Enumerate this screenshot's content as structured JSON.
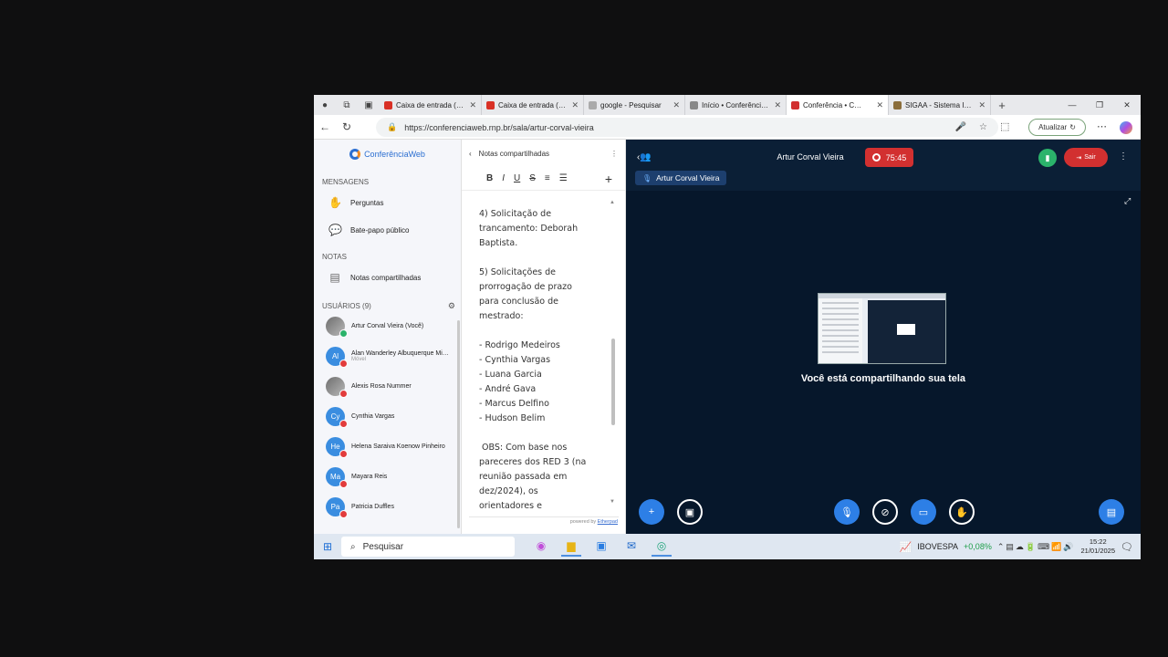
{
  "browser": {
    "tabs": [
      {
        "title": "Caixa de entrada (2…",
        "color": "#d93025",
        "active": false
      },
      {
        "title": "Caixa de entrada (1…",
        "color": "#d93025",
        "active": false
      },
      {
        "title": "google - Pesquisar",
        "color": "#aaaaaa",
        "active": false
      },
      {
        "title": "Início • Conferênci…",
        "color": "#888888",
        "active": false
      },
      {
        "title": "Conferência • C…",
        "color": "#d23030",
        "active": true
      },
      {
        "title": "SIGAA - Sistema Int…",
        "color": "#8a6d3b",
        "active": false
      }
    ],
    "url": "https://conferenciaweb.rnp.br/sala/artur-corval-vieira",
    "update_label": "Atualizar"
  },
  "sidebar": {
    "logo": "ConferênciaWeb",
    "messages_heading": "MENSAGENS",
    "questions_label": "Perguntas",
    "chat_label": "Bate-papo público",
    "notes_heading": "NOTAS",
    "shared_notes_label": "Notas compartilhadas",
    "users_heading": "USUÁRIOS",
    "users_count": "(9)",
    "users": [
      {
        "initials": "",
        "name": "Artur Corval Vieira (Você)",
        "sub": "",
        "photo": true,
        "ok": true
      },
      {
        "initials": "Al",
        "name": "Alan Wanderley Albuquerque Mi…",
        "sub": "Móvel",
        "photo": false,
        "ok": false
      },
      {
        "initials": "",
        "name": "Alexis Rosa Nummer",
        "sub": "",
        "photo": true,
        "ok": false
      },
      {
        "initials": "Cy",
        "name": "Cynthia Vargas",
        "sub": "",
        "photo": false,
        "ok": false
      },
      {
        "initials": "He",
        "name": "Helena Saraiva Koenow Pinheiro",
        "sub": "",
        "photo": false,
        "ok": false
      },
      {
        "initials": "Ma",
        "name": "Mayara Reis",
        "sub": "",
        "photo": false,
        "ok": false
      },
      {
        "initials": "Pa",
        "name": "Patricia Duffles",
        "sub": "",
        "photo": false,
        "ok": false
      }
    ]
  },
  "notes": {
    "title": "Notas compartilhadas",
    "toolbar": [
      "B",
      "I",
      "U",
      "S"
    ],
    "content": "4) Solicitação de\ntrancamento: Deborah\nBaptista.\n\n5) Solicitações de\nprorrogação de prazo\npara conclusão de\nmestrado:\n\n- Rodrigo Medeiros\n- Cynthia Vargas\n- Luana Garcia\n- André Gava\n- Marcus Delfino\n- Hudson Belim\n\n OBS: Com base nos\npareceres dos RED 3 (na\nreunião passada em\ndez/2024), os\norientadores e",
    "powered_prefix": "powered by",
    "powered_link": "Etherpad"
  },
  "conference": {
    "title": "Artur Corval Vieira",
    "timer": "75:45",
    "leave_label": "Sair",
    "presenter": "Artur Corval Vieira",
    "sharing_text": "Você está compartilhando sua tela"
  },
  "taskbar": {
    "search_placeholder": "Pesquisar",
    "stock_name": "IBOVESPA",
    "stock_change": "+0,08%",
    "time": "15:22",
    "date": "21/01/2025"
  }
}
